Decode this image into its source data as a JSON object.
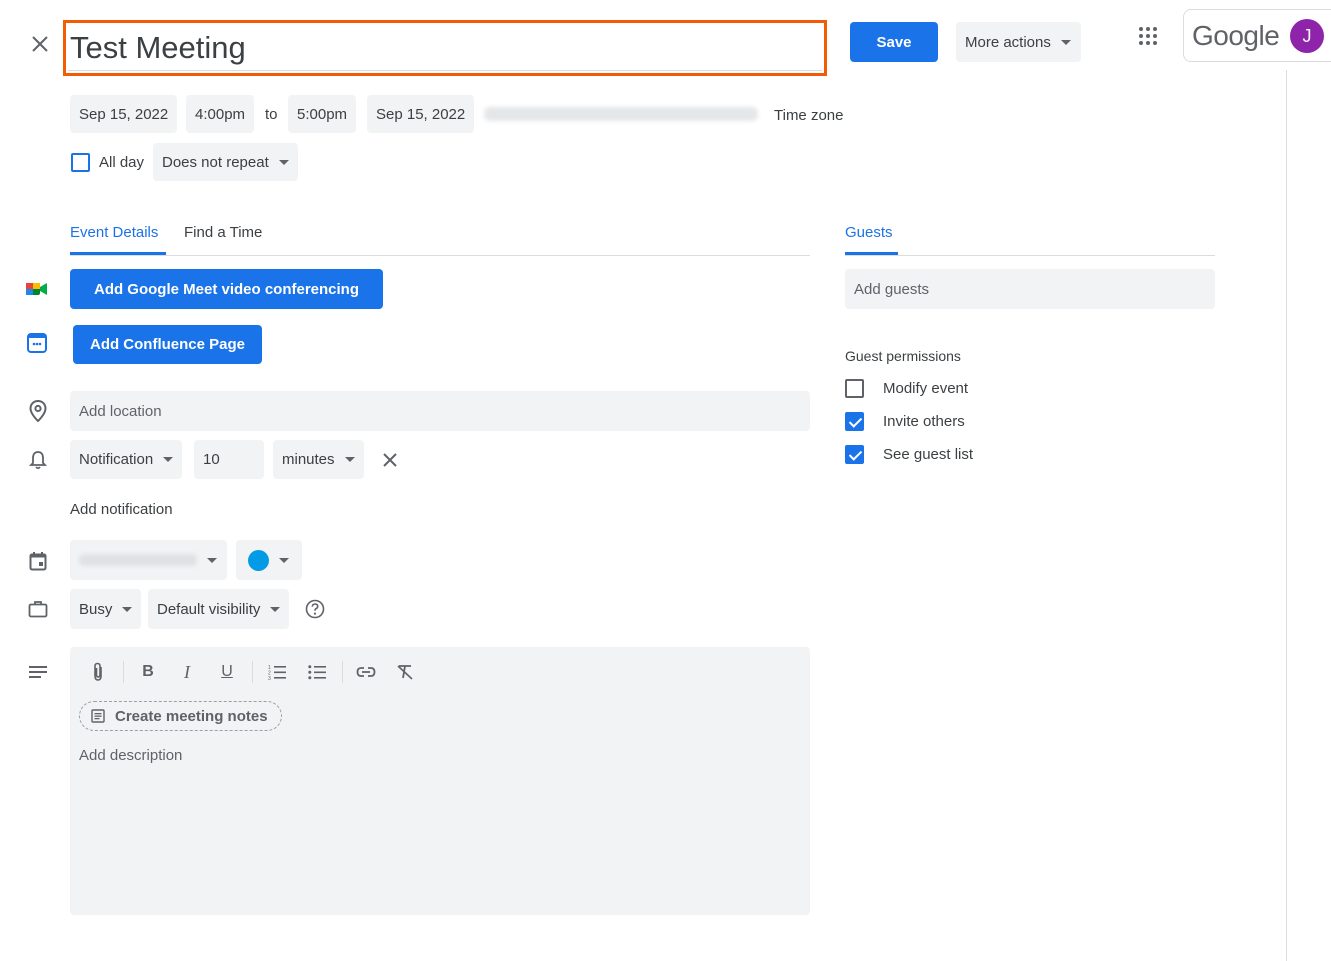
{
  "header": {
    "title_value": "Test Meeting",
    "save_label": "Save",
    "more_actions_label": "More actions",
    "google_label": "Google",
    "avatar_initial": "J"
  },
  "datetime": {
    "start_date": "Sep 15, 2022",
    "start_time": "4:00pm",
    "to_label": "to",
    "end_time": "5:00pm",
    "end_date": "Sep 15, 2022",
    "timezone_label": "Time zone",
    "all_day_label": "All day",
    "repeat_label": "Does not repeat"
  },
  "tabs": {
    "event_details": "Event Details",
    "find_time": "Find a Time"
  },
  "details": {
    "meet_button": "Add Google Meet video conferencing",
    "confluence_button": "Add Confluence Page",
    "location_placeholder": "Add location",
    "notification_type": "Notification",
    "notification_value": "10",
    "notification_unit": "minutes",
    "add_notification": "Add notification",
    "busy_label": "Busy",
    "visibility_label": "Default visibility",
    "meeting_notes_label": "Create meeting notes",
    "description_placeholder": "Add description"
  },
  "guests": {
    "tab_label": "Guests",
    "add_placeholder": "Add guests",
    "permissions_title": "Guest permissions",
    "permissions": [
      {
        "label": "Modify event",
        "checked": false
      },
      {
        "label": "Invite others",
        "checked": true
      },
      {
        "label": "See guest list",
        "checked": true
      }
    ]
  },
  "colors": {
    "primary": "#1a73e8",
    "highlight_border": "#f25c05",
    "calendar_color": "#039be5",
    "avatar": "#8e24aa"
  }
}
